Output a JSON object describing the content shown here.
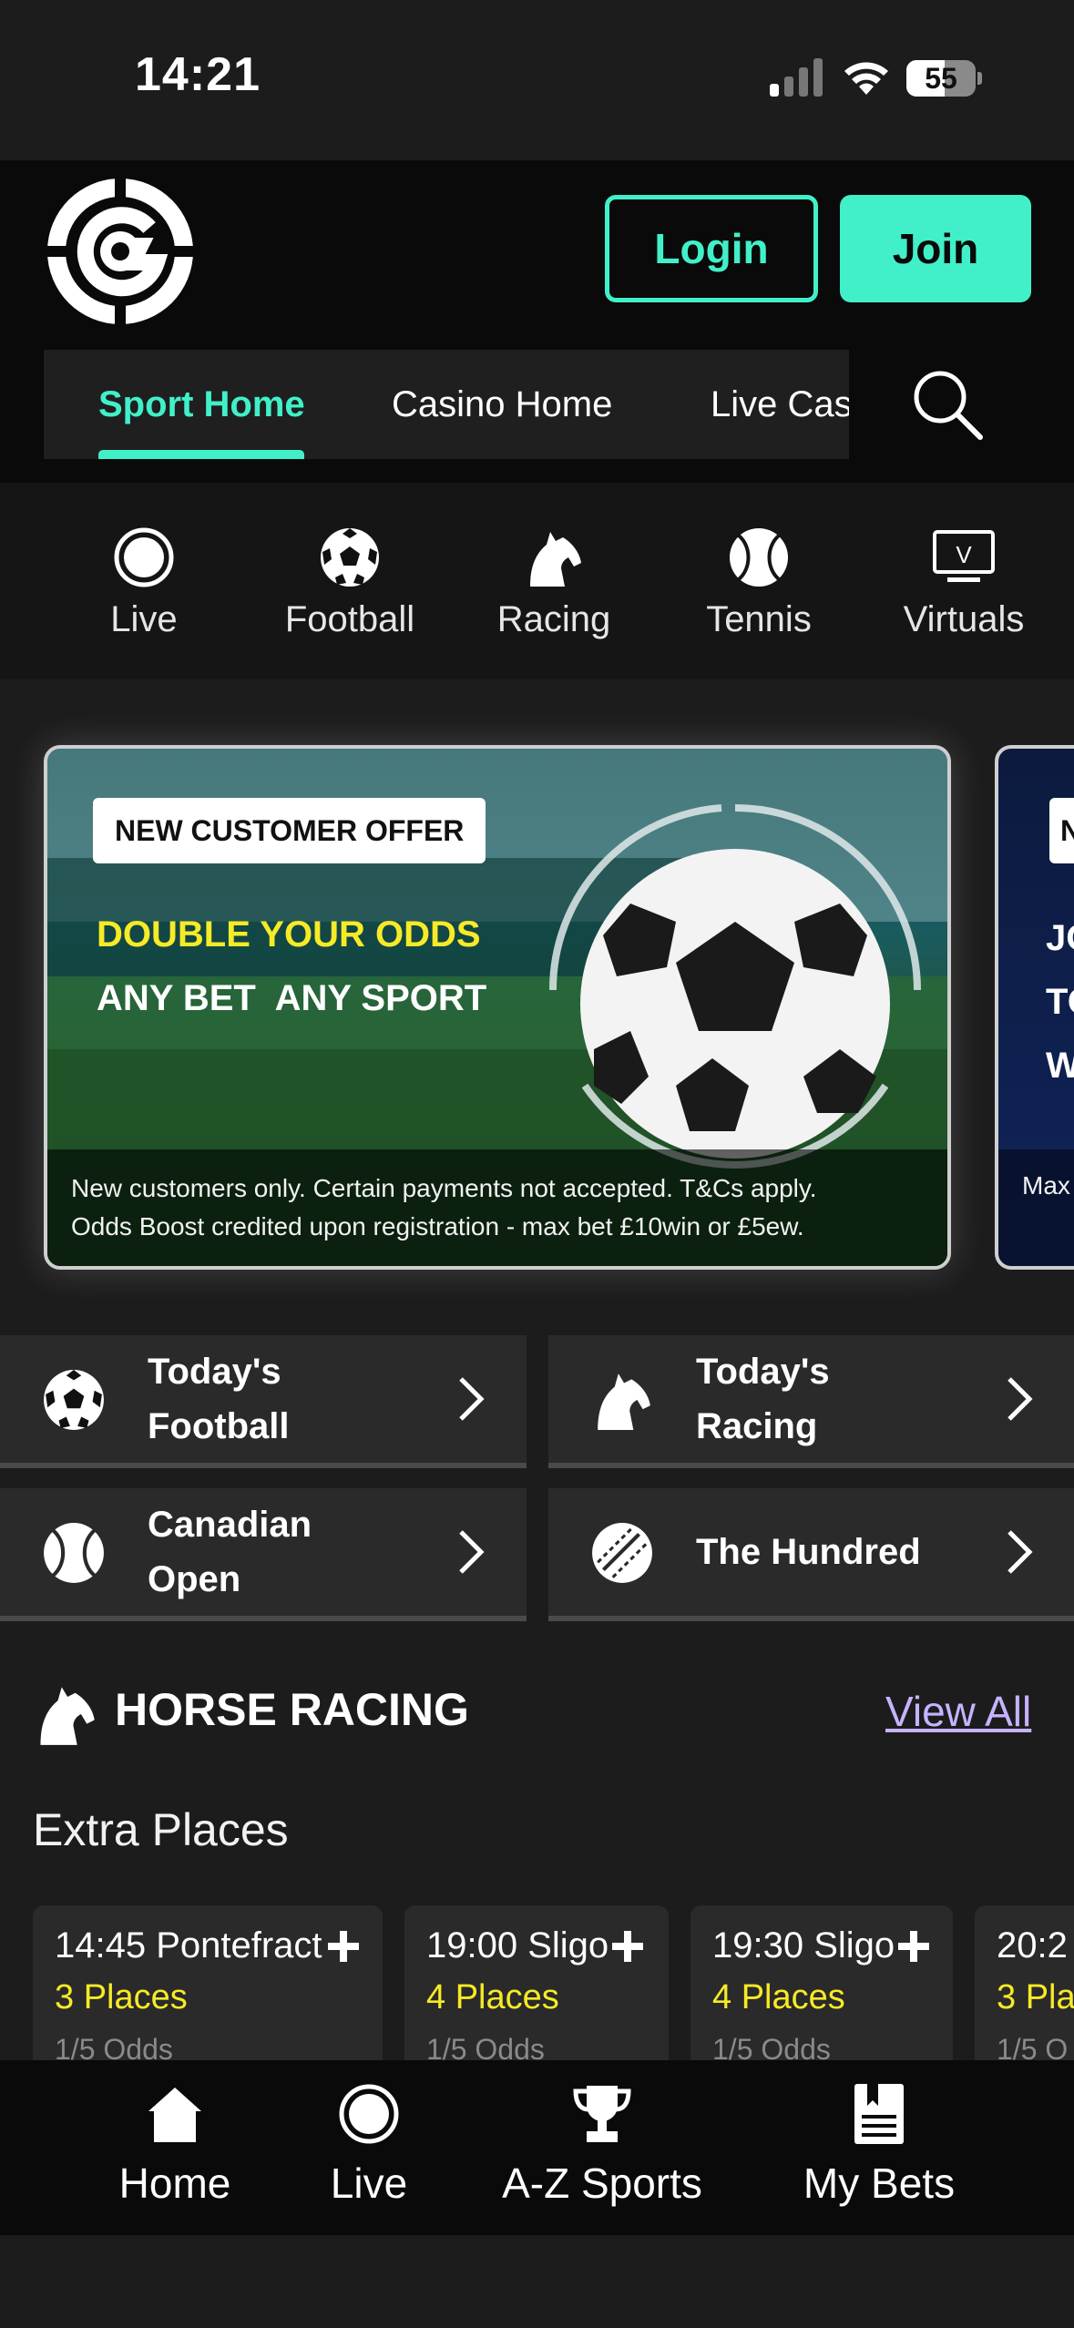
{
  "status_bar": {
    "time": "14:21",
    "battery": "55",
    "battery_level": 0.55
  },
  "header": {
    "login_label": "Login",
    "join_label": "Join"
  },
  "nav_tabs": [
    {
      "label": "Sport Home",
      "active": true
    },
    {
      "label": "Casino Home",
      "active": false
    },
    {
      "label": "Live Cas",
      "active": false
    }
  ],
  "sports": [
    {
      "label": "Live",
      "icon": "live-icon"
    },
    {
      "label": "Football",
      "icon": "football-icon"
    },
    {
      "label": "Racing",
      "icon": "horse-icon"
    },
    {
      "label": "Tennis",
      "icon": "tennis-icon"
    },
    {
      "label": "Virtuals",
      "icon": "virtuals-icon"
    }
  ],
  "promo": {
    "badge": "NEW CUSTOMER OFFER",
    "headline": "DOUBLE YOUR ODDS",
    "subline": "ANY BET  ANY SPORT",
    "disclaimer_line1": "New customers only. Certain payments not accepted. T&Cs apply.",
    "disclaimer_line2": "Odds Boost credited upon registration - max bet £10win or £5ew."
  },
  "promo2": {
    "badge": "N",
    "line1": "JO",
    "line2": "TO",
    "line3": "W",
    "disclaimer": "Max"
  },
  "quick_links": [
    {
      "label_line1": "Today's",
      "label_line2": "Football",
      "icon": "football-icon"
    },
    {
      "label_line1": "Today's",
      "label_line2": "Racing",
      "icon": "horse-icon"
    },
    {
      "label_line1": "Canadian",
      "label_line2": "Open",
      "icon": "tennis-icon"
    },
    {
      "label_line1": "The Hundred",
      "label_line2": "",
      "icon": "cricket-icon"
    }
  ],
  "horse_racing": {
    "title": "HORSE RACING",
    "view_all": "View All",
    "subtitle": "Extra Places",
    "races": [
      {
        "time": "14:45 Pontefract",
        "places": "3 Places",
        "odds": "1/5 Odds"
      },
      {
        "time": "19:00 Sligo",
        "places": "4 Places",
        "odds": "1/5 Odds"
      },
      {
        "time": "19:30 Sligo",
        "places": "4 Places",
        "odds": "1/5 Odds"
      },
      {
        "time": "20:2",
        "places": "3 Pla",
        "odds": "1/5 O"
      }
    ]
  },
  "bottom_nav": [
    {
      "label": "Home",
      "icon": "home-icon"
    },
    {
      "label": "Live",
      "icon": "live-icon"
    },
    {
      "label": "A-Z Sports",
      "icon": "trophy-icon"
    },
    {
      "label": "My Bets",
      "icon": "bet-slip-icon"
    }
  ],
  "colors": {
    "accent": "#41f0c8",
    "highlight": "#f7ea26",
    "link": "#c6b3ff",
    "background": "#1c1c1c"
  }
}
